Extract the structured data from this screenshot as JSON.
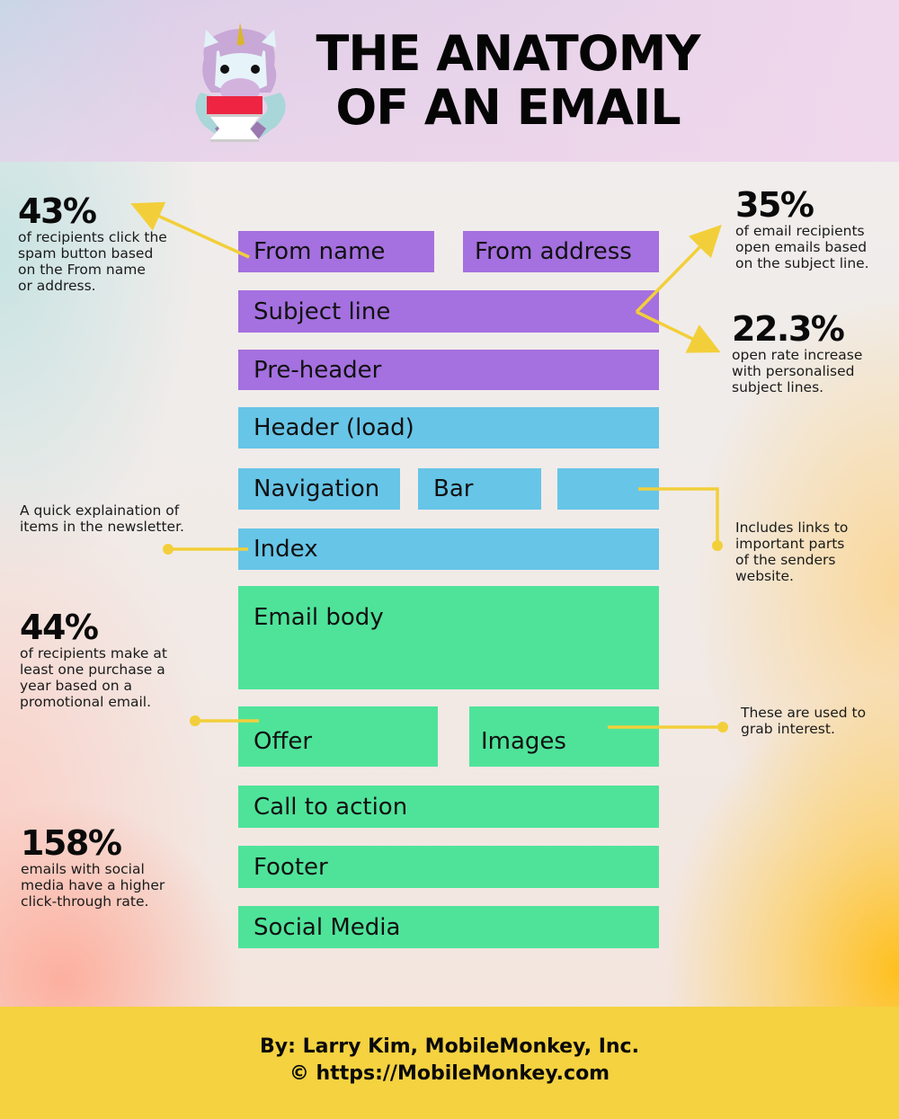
{
  "title": {
    "line1": "THE ANATOMY",
    "line2": "OF AN EMAIL"
  },
  "mascot": {
    "icon": "unicorn-holding-email-icon"
  },
  "colors": {
    "purple_block": "#a570df",
    "blue_block": "#67c5e7",
    "green_block": "#4fe39a",
    "connector": "#f2cf3a",
    "footer_band": "#f4d240"
  },
  "email_sections": {
    "from_name": "From name",
    "from_address": "From address",
    "subject_line": "Subject line",
    "pre_header": "Pre-header",
    "header": "Header (load)",
    "navigation": "Navigation",
    "bar": "Bar",
    "nav_extra": "",
    "index": "Index",
    "email_body": "Email body",
    "offer": "Offer",
    "images": "Images",
    "call_to_action": "Call to action",
    "footer": "Footer",
    "social_media": "Social Media"
  },
  "stats": {
    "from": {
      "value": "43%",
      "description": "of recipients click the\nspam button based\non the From name\nor address."
    },
    "subject_open": {
      "value": "35%",
      "description": "of email recipients\nopen emails based\non the subject line."
    },
    "personalised": {
      "value": "22.3%",
      "description": "open rate increase\nwith personalised\nsubject lines."
    },
    "purchase": {
      "value": "44%",
      "description": "of recipients make at\nleast one purchase a\nyear based on a\npromotional email."
    },
    "social": {
      "value": "158%",
      "description": "emails with social\nmedia have a higher\nclick-through rate."
    }
  },
  "notes": {
    "index": "A quick explaination of\nitems in the newsletter.",
    "navigation": "Includes links to\nimportant parts\nof the senders\nwebsite.",
    "images": "These are used to\ngrab interest."
  },
  "credits": {
    "author": "By: Larry Kim, MobileMonkey, Inc.",
    "url": "© https://MobileMonkey.com"
  }
}
